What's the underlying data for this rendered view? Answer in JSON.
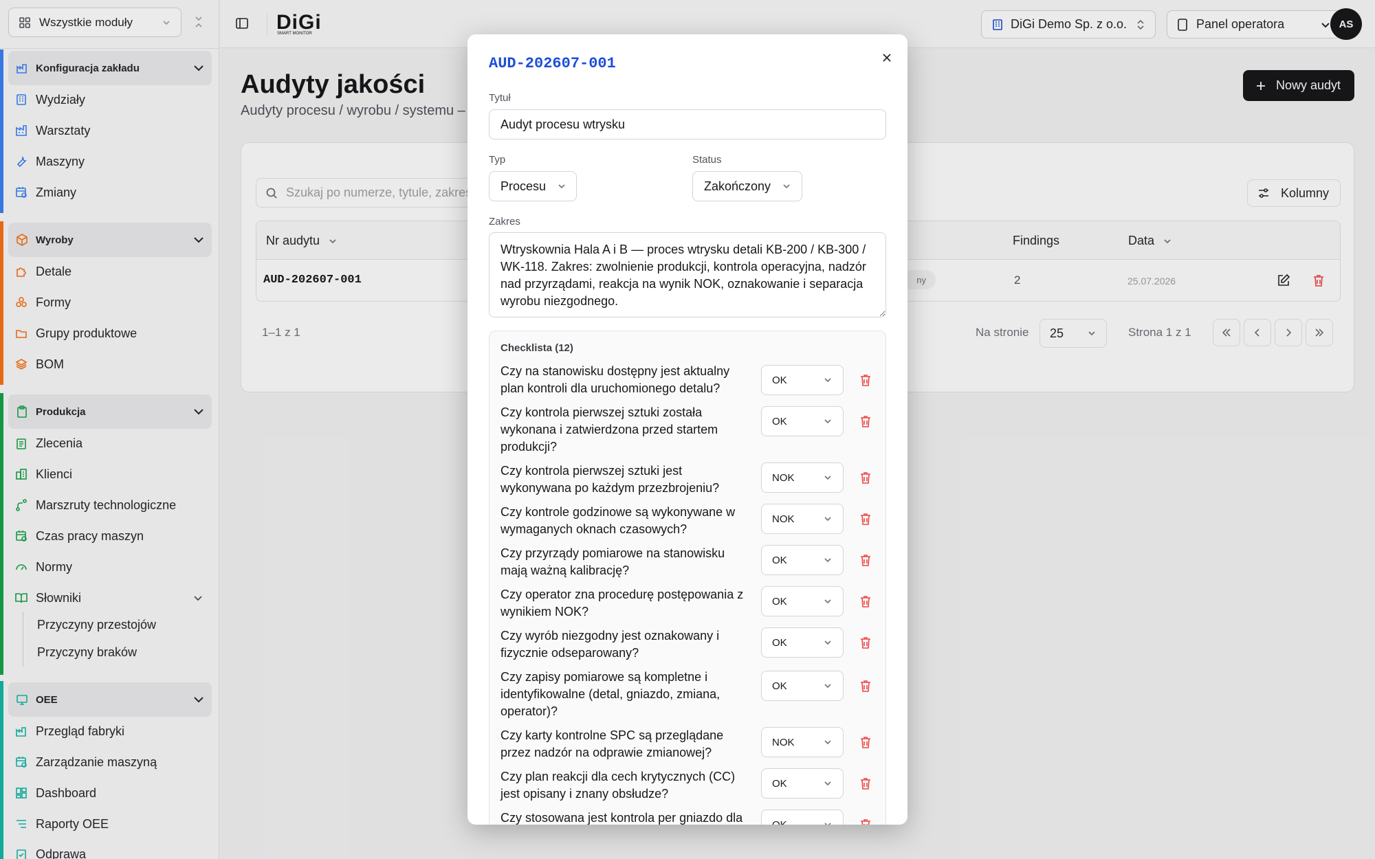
{
  "sidebar": {
    "module_select": "Wszystkie moduły",
    "groups": [
      {
        "title": "Konfiguracja zakładu",
        "color": "#3b82f6",
        "items": [
          "Wydziały",
          "Warsztaty",
          "Maszyny",
          "Zmiany"
        ]
      },
      {
        "title": "Wyroby",
        "color": "#f97316",
        "items": [
          "Detale",
          "Formy",
          "Grupy produktowe",
          "BOM"
        ]
      },
      {
        "title": "Produkcja",
        "color": "#16a34a",
        "items": [
          "Zlecenia",
          "Klienci",
          "Marszruty technologiczne",
          "Czas pracy maszyn",
          "Normy",
          "Słowniki"
        ],
        "sub_items": [
          "Przyczyny przestojów",
          "Przyczyny braków"
        ]
      },
      {
        "title": "OEE",
        "color": "#14b8a6",
        "items": [
          "Przegląd fabryki",
          "Zarządzanie maszyną",
          "Dashboard",
          "Raporty OEE",
          "Odprawa"
        ]
      }
    ]
  },
  "topbar": {
    "logo_text": "DiGi",
    "logo_sub": "SMART MONITOR",
    "company": "DiGi Demo Sp. z o.o.",
    "panel": "Panel operatora",
    "avatar": "AS"
  },
  "page": {
    "title": "Audyty jakości",
    "subtitle": "Audyty procesu / wyrobu / systemu –",
    "new_button": "Nowy audyt",
    "search_placeholder": "Szukaj po numerze, tytule, zakresie",
    "columns_button": "Kolumny",
    "table": {
      "headers": {
        "number": "Nr audytu",
        "findings": "Findings",
        "date": "Data"
      },
      "rows": [
        {
          "number": "AUD-202607-001",
          "status_fragment": "ny",
          "findings": "2",
          "date": "25.07.2026"
        }
      ]
    },
    "range_text": "1–1 z 1",
    "per_page_label": "Na stronie",
    "per_page_value": "25",
    "page_info": "Strona 1 z 1"
  },
  "modal": {
    "title": "AUD-202607-001",
    "title_label": "Tytuł",
    "title_value": "Audyt procesu wtrysku",
    "type_label": "Typ",
    "type_value": "Procesu",
    "status_label": "Status",
    "status_value": "Zakończony",
    "scope_label": "Zakres",
    "scope_value": "Wtryskownia Hala A i B — proces wtrysku detali KB-200 / KB-300 / WK-118. Zakres: zwolnienie produkcji, kontrola operacyjna, nadzór nad przyrządami, reakcja na wynik NOK, oznakowanie i separacja wyrobu niezgodnego.",
    "checklist_title": "Checklista (12)",
    "checklist": [
      {
        "q": "Czy na stanowisku dostępny jest aktualny plan kontroli dla uruchomionego detalu?",
        "v": "OK"
      },
      {
        "q": "Czy kontrola pierwszej sztuki została wykonana i zatwierdzona przed startem produkcji?",
        "v": "OK"
      },
      {
        "q": "Czy kontrola pierwszej sztuki jest wykonywana po każdym przezbrojeniu?",
        "v": "NOK"
      },
      {
        "q": "Czy kontrole godzinowe są wykonywane w wymaganych oknach czasowych?",
        "v": "NOK"
      },
      {
        "q": "Czy przyrządy pomiarowe na stanowisku mają ważną kalibrację?",
        "v": "OK"
      },
      {
        "q": "Czy operator zna procedurę postępowania z wynikiem NOK?",
        "v": "OK"
      },
      {
        "q": "Czy wyrób niezgodny jest oznakowany i fizycznie odseparowany?",
        "v": "OK"
      },
      {
        "q": "Czy zapisy pomiarowe są kompletne i identyfikowalne (detal, gniazdo, zmiana, operator)?",
        "v": "OK"
      },
      {
        "q": "Czy karty kontrolne SPC są przeglądane przez nadzór na odprawie zmianowej?",
        "v": "NOK"
      },
      {
        "q": "Czy plan reakcji dla cech krytycznych (CC) jest opisany i znany obsłudze?",
        "v": "OK"
      },
      {
        "q": "Czy stosowana jest kontrola per gniazdo dla",
        "v": "OK"
      }
    ]
  },
  "colors": {
    "accent_blue": "#1d4ed8",
    "danger": "#ef4444",
    "dark": "#18181b"
  }
}
